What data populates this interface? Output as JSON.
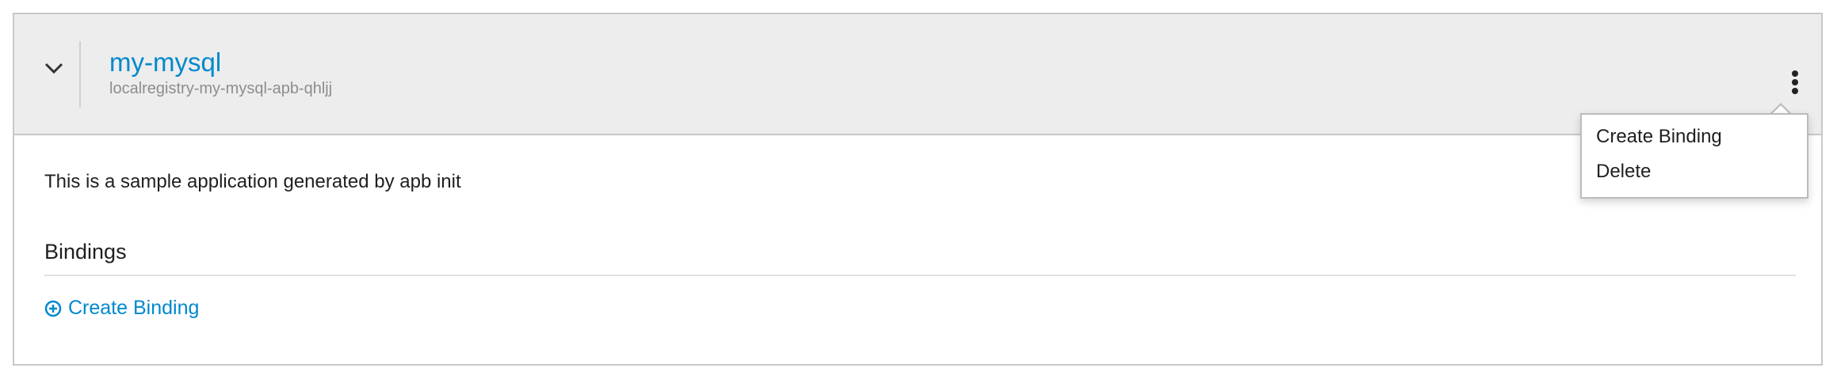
{
  "service": {
    "title": "my-mysql",
    "subtitle": "localregistry-my-mysql-apb-qhljj",
    "description": "This is a sample application generated by apb init"
  },
  "bindings": {
    "heading": "Bindings",
    "create_label": "Create Binding"
  },
  "actions_menu": {
    "items": [
      {
        "label": "Create Binding"
      },
      {
        "label": "Delete"
      }
    ]
  },
  "colors": {
    "link": "#0088ce",
    "header_bg": "#ededed",
    "border": "#c8c8c8"
  },
  "icons": {
    "toggle": "chevron-down-icon",
    "kebab": "kebab-icon",
    "create": "plus-circle-icon"
  }
}
